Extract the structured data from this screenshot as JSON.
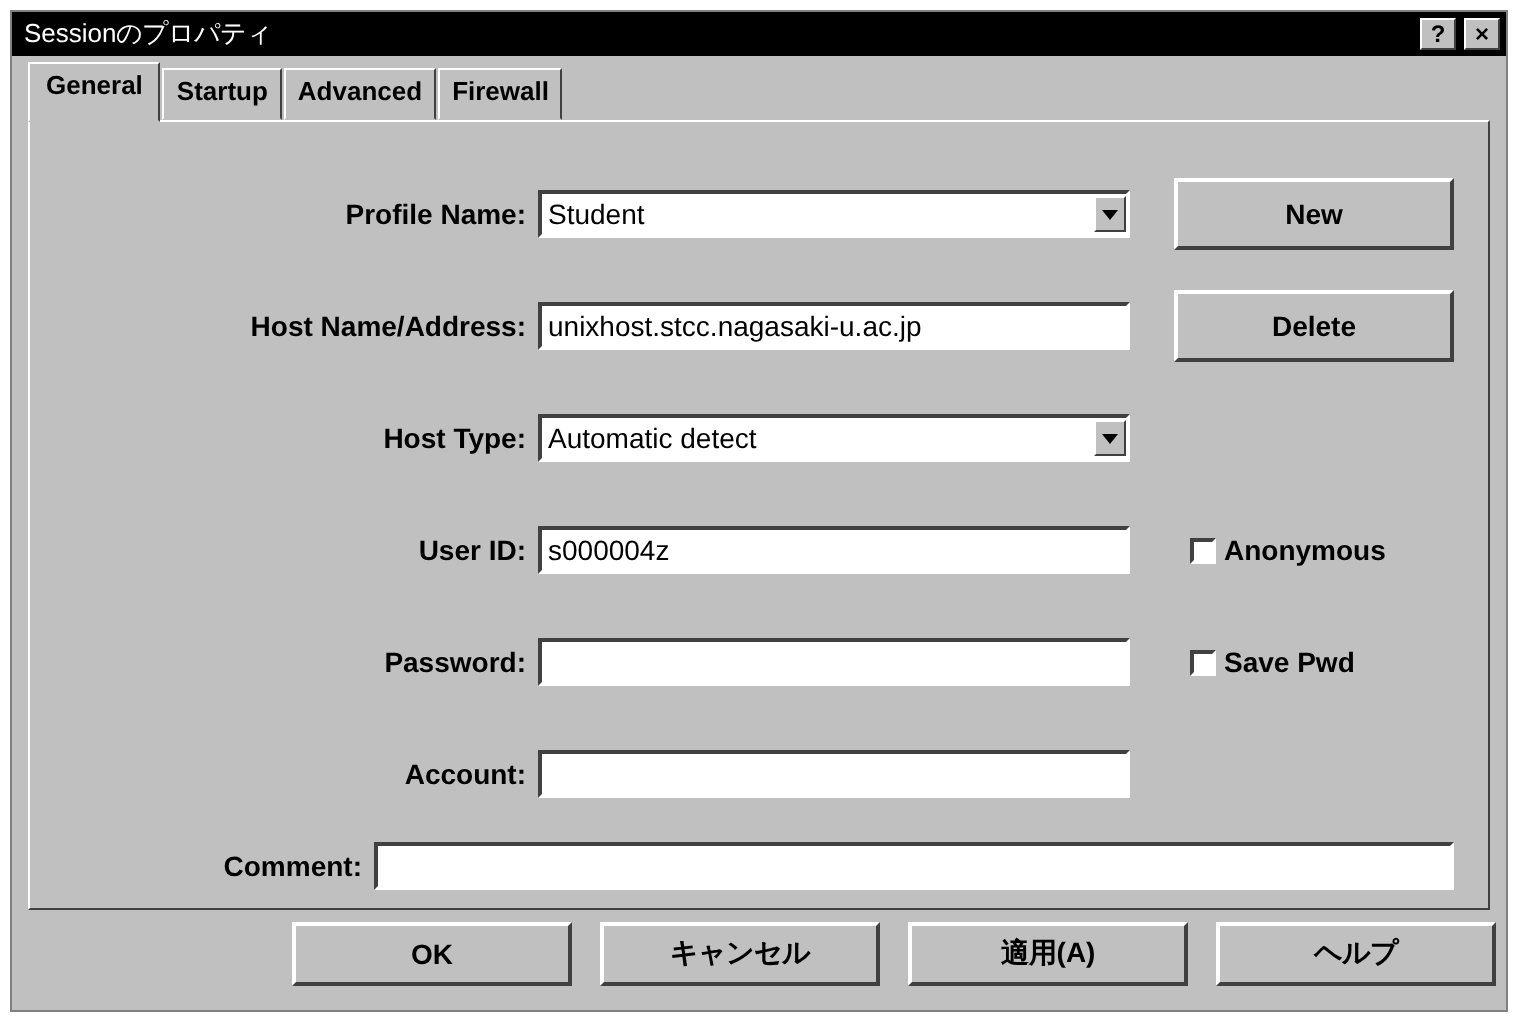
{
  "window": {
    "title": "Sessionのプロパティ",
    "help": "?",
    "close": "×"
  },
  "tabs": [
    {
      "label": "General",
      "selected": true
    },
    {
      "label": "Startup",
      "selected": false
    },
    {
      "label": "Advanced",
      "selected": false
    },
    {
      "label": "Firewall",
      "selected": false
    }
  ],
  "fields": [
    {
      "label": "Profile Name:",
      "kind": "dropdown",
      "value": "Student"
    },
    {
      "label": "Host Name/Address:",
      "kind": "text",
      "value": "unixhost.stcc.nagasaki-u.ac.jp"
    },
    {
      "label": "Host Type:",
      "kind": "dropdown",
      "value": "Automatic detect"
    },
    {
      "label": "User ID:",
      "kind": "text",
      "value": "s000004z",
      "checkbox": {
        "label": "Anonymous",
        "checked": false
      }
    },
    {
      "label": "Password:",
      "kind": "text",
      "checkbox": {
        "label": "Save Pwd",
        "checked": false
      }
    },
    {
      "label": "Account:",
      "kind": "text"
    }
  ],
  "side_buttons": [
    "New",
    "Delete"
  ],
  "comment": {
    "label": "Comment:"
  },
  "buttons": [
    "OK",
    "キャンセル",
    "適用(A)",
    "ヘルプ"
  ]
}
